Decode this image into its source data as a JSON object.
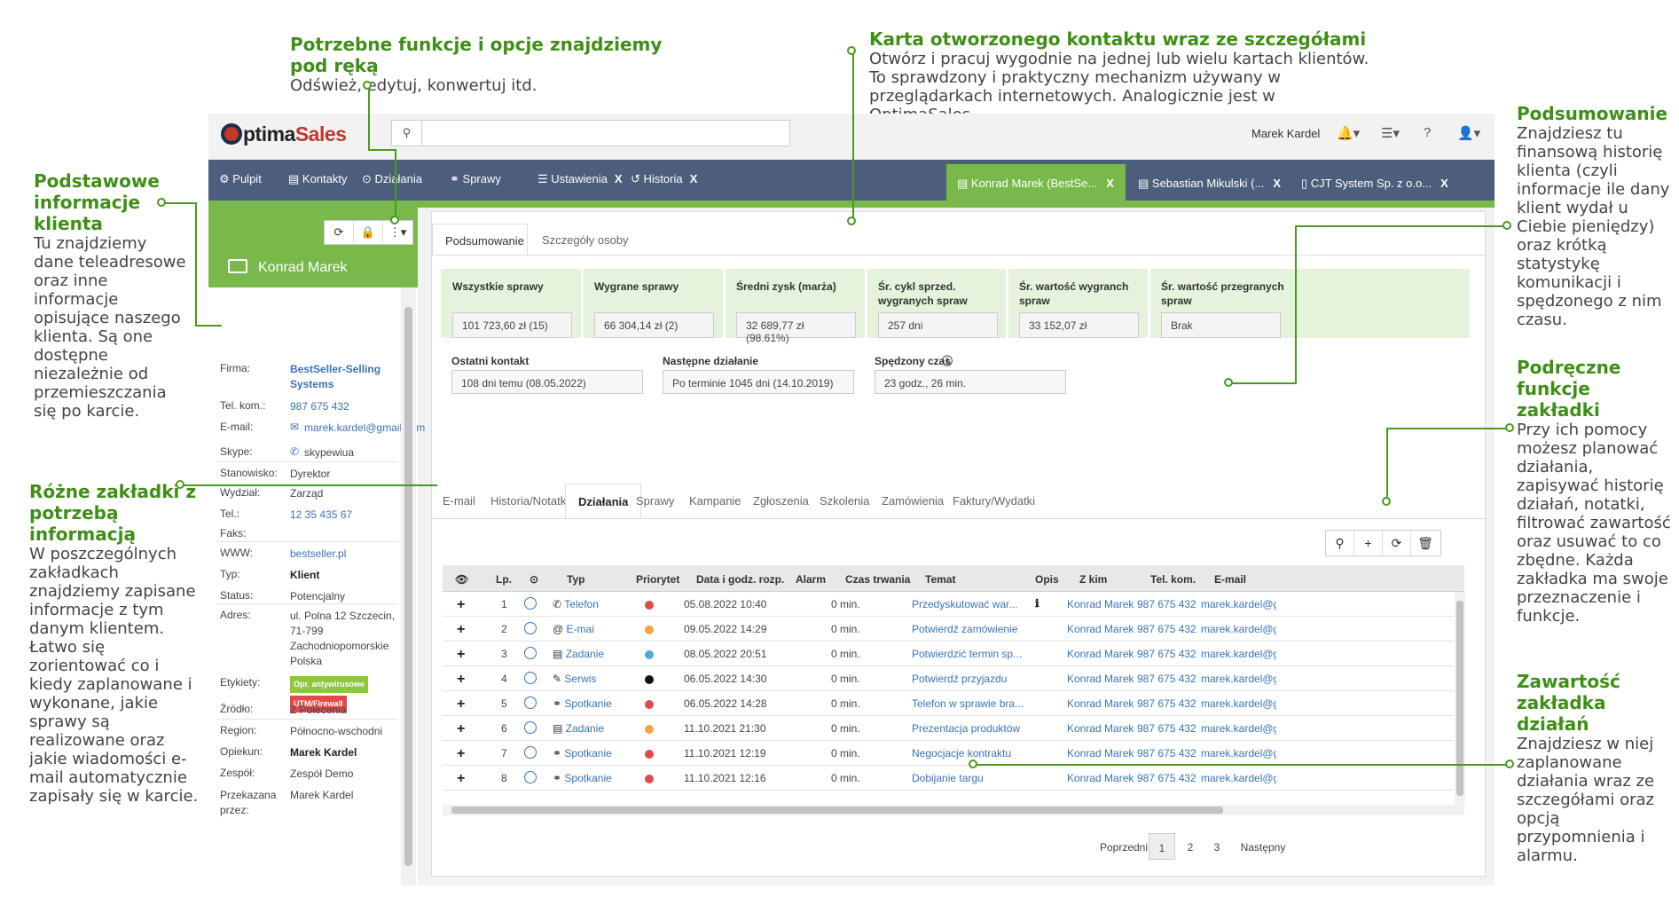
{
  "annotations": [
    {
      "id": "functions",
      "title": "Potrzebne funkcje i opcje znajdziemy pod ręką",
      "desc": "Odśwież, edytuj, konwertuj itd."
    },
    {
      "id": "card",
      "title": "Karta otworzonego kontaktu wraz ze szczegółami",
      "desc": "Otwórz i pracuj wygodnie na jednej lub wielu kartach klientów. To sprawdzony i praktyczny mechanizm używany w przeglądarkach internetowych. Analogicznie jest w OptimaSales."
    },
    {
      "id": "summary",
      "title": "Podsumowanie",
      "desc": "Znajdziesz tu finansową historię klienta (czyli informacje ile dany klient wydał u Ciebie pieniędzy) oraz krótką statystykę komunikacji i spędzonego z nim czasu."
    },
    {
      "id": "basic",
      "title": "Podstawowe informacje klienta",
      "desc": "Tu znajdziemy dane teleadresowe oraz inne informacje opisujące naszego klienta. Są one dostępne niezależnie od przemieszczania się po karcie."
    },
    {
      "id": "tabfunc",
      "title": "Podręczne funkcje zakładki",
      "desc": "Przy ich pomocy możesz planować działania, zapisywać historię działań, notatki, filtrować zawartość oraz usuwać to co zbędne. Każda zakładka ma swoje przeznaczenie i funkcje."
    },
    {
      "id": "tabs",
      "title": "Różne zakładki z potrzebą informacją",
      "desc": "W poszczególnych zakładkach znajdziemy zapisane informacje z tym danym klientem. Łatwo się zorientować co i kiedy zaplanowane i wykonane, jakie sprawy są realizowane oraz jakie wiadomości e-mail automatycznie zapisały się w karcie."
    },
    {
      "id": "content",
      "title": "Zawartość zakładka działań",
      "desc": "Znajdziesz w niej zaplanowane działania wraz ze szczegółami oraz opcją przypomnienia i alarmu."
    }
  ],
  "app": {
    "logo_o": "O",
    "logo_text": "ptima",
    "logo_sales": "Sales",
    "user_name": "Marek Kardel",
    "nav": [
      {
        "label": "Pulpit",
        "icon": "dashboard-icon",
        "glyph": "⚙",
        "closable": false
      },
      {
        "label": "Kontakty",
        "icon": "contacts-icon",
        "glyph": "▤",
        "closable": false
      },
      {
        "label": "Działania",
        "icon": "check-circle-icon",
        "glyph": "⊙",
        "closable": false
      },
      {
        "label": "Sprawy",
        "icon": "handshake-icon",
        "glyph": "⚭",
        "closable": false
      },
      {
        "label": "Ustawienia",
        "icon": "sliders-icon",
        "glyph": "☰",
        "closable": true
      },
      {
        "label": "Historia",
        "icon": "history-icon",
        "glyph": "↺",
        "closable": true
      }
    ],
    "close_glyph": "X",
    "card_tabs": [
      {
        "label": "Konrad Marek (BestSe...",
        "active": true
      },
      {
        "label": "Sebastian Mikulski (...",
        "active": false
      },
      {
        "label": "CJT System Sp. z o.o...",
        "active": false
      }
    ]
  },
  "contact": {
    "name": "Konrad Marek",
    "fields": [
      {
        "key": "Firma:",
        "value": "BestSeller-Selling Systems",
        "style": "link-bold"
      },
      {
        "key": "Tel. kom.:",
        "value": "987 675 432",
        "style": "link"
      },
      {
        "key": "E-mail:",
        "value": "marek.kardel@gmail.com",
        "style": "link"
      },
      {
        "key": "Skype:",
        "value": "skypewiua",
        "style": "plain"
      },
      {
        "key": "Stanowisko:",
        "value": "Dyrektor",
        "style": "plain"
      },
      {
        "key": "Wydział:",
        "value": "Zarząd",
        "style": "plain"
      },
      {
        "key": "Tel.:",
        "value": "12 35 435 67",
        "style": "link"
      },
      {
        "key": "Faks:",
        "value": "",
        "style": "plain"
      },
      {
        "key": "WWW:",
        "value": "bestseller.pl",
        "style": "link"
      },
      {
        "key": "Typ:",
        "value": "Klient",
        "style": "bold"
      },
      {
        "key": "Status:",
        "value": "Potencjalny",
        "style": "plain"
      },
      {
        "key": "Adres:",
        "value": "ul. Polna 12 Szczecin, 71-799 Zachodniopomorskie Polska",
        "style": "plain"
      },
      {
        "key": "Etykiety:",
        "value": "",
        "style": "plain"
      },
      {
        "key": "Źródło:",
        "value": "Z Polecenia",
        "style": "plain"
      },
      {
        "key": "Region:",
        "value": "Północno-wschodni",
        "style": "plain"
      },
      {
        "key": "Opiekun:",
        "value": "Marek Kardel",
        "style": "bold"
      },
      {
        "key": "Zespół:",
        "value": "Zespół Demo",
        "style": "plain"
      },
      {
        "key": "Przekazana przez:",
        "value": "Marek Kardel",
        "style": "plain"
      }
    ],
    "tags": [
      {
        "label": "Opr. antywirusowe",
        "color": "#8dc63f"
      },
      {
        "label": "UTM/Firewall",
        "color": "#e04a4a"
      }
    ]
  },
  "summary_tabs": [
    "Podsumowanie",
    "Szczegóły osoby"
  ],
  "summary": [
    {
      "label": "Wszystkie sprawy",
      "value": "101 723,60 zł (15)"
    },
    {
      "label": "Wygrane sprawy",
      "value": "66 304,14 zł (2)"
    },
    {
      "label": "Średni zysk (marża)",
      "value": "32 689,77 zł (98.61%)"
    },
    {
      "label": "Śr. cykl sprzed. wygranych spraw",
      "value": "257 dni"
    },
    {
      "label": "Śr. wartość wygranch spraw",
      "value": "33 152,07 zł"
    },
    {
      "label": "Śr. wartość przegranych spraw",
      "value": "Brak"
    }
  ],
  "summary2": [
    {
      "label": "Ostatni kontakt",
      "value": "108 dni temu (08.05.2022)"
    },
    {
      "label": "Następne działanie",
      "value": "Po terminie 1045 dni (14.10.2019)"
    },
    {
      "label": "Spędzony czas",
      "value": "23 godz., 26 min."
    }
  ],
  "bottom_tabs": [
    "E-mail",
    "Historia/Notatki",
    "Działania",
    "Sprawy",
    "Kampanie",
    "Zgłoszenia",
    "Szkolenia",
    "Zamówienia",
    "Faktury/Wydatki"
  ],
  "table": {
    "headers": [
      "Lp.",
      "Typ",
      "Priorytet",
      "Data i godz. rozp.",
      "Alarm",
      "Czas trwania",
      "Temat",
      "Opis",
      "Z kim",
      "Tel. kom.",
      "E-mail"
    ],
    "rows": [
      {
        "lp": "1",
        "type": "Telefon",
        "type_glyph": "✆",
        "prio": "#e04a4a",
        "date": "05.08.2022 10:40",
        "dur": "0 min.",
        "topic": "Przedyskutować war...",
        "desc": "ℹ",
        "who": "Konrad Marek",
        "tel": "987 675 432",
        "mail": "marek.kardel@gm"
      },
      {
        "lp": "2",
        "type": "E-mai",
        "type_glyph": "@",
        "prio": "#f5a34a",
        "date": "09.05.2022 14:29",
        "dur": "0 min.",
        "topic": "Potwierdź zamówienie",
        "desc": "",
        "who": "Konrad Marek",
        "tel": "987 675 432",
        "mail": "marek.kardel@gm"
      },
      {
        "lp": "3",
        "type": "Zadanie",
        "type_glyph": "▤",
        "prio": "#4aaee0",
        "date": "08.05.2022 20:51",
        "dur": "0 min.",
        "topic": "Potwierdzić termin sp...",
        "desc": "",
        "who": "Konrad Marek",
        "tel": "987 675 432",
        "mail": "marek.kardel@gm"
      },
      {
        "lp": "4",
        "type": "Serwis",
        "type_glyph": "✎",
        "prio": "#111111",
        "date": "06.05.2022 14:30",
        "dur": "0 min.",
        "topic": "Potwierdź przyjazdu",
        "desc": "",
        "who": "Konrad Marek",
        "tel": "987 675 432",
        "mail": "marek.kardel@gm"
      },
      {
        "lp": "5",
        "type": "Spotkanie",
        "type_glyph": "⚭",
        "prio": "#e04a4a",
        "date": "06.05.2022 14:28",
        "dur": "0 min.",
        "topic": "Telefon w sprawie bra...",
        "desc": "",
        "who": "Konrad Marek",
        "tel": "987 675 432",
        "mail": "marek.kardel@gm"
      },
      {
        "lp": "6",
        "type": "Zadanie",
        "type_glyph": "▤",
        "prio": "#f5a34a",
        "date": "11.10.2021 21:30",
        "dur": "0 min.",
        "topic": "Prezentacja produktów",
        "desc": "",
        "who": "Konrad Marek",
        "tel": "987 675 432",
        "mail": "marek.kardel@gm"
      },
      {
        "lp": "7",
        "type": "Spotkanie",
        "type_glyph": "⚭",
        "prio": "#e04a4a",
        "date": "11.10.2021 12:19",
        "dur": "0 min.",
        "topic": "Negocjacje kontraktu",
        "desc": "",
        "who": "Konrad Marek",
        "tel": "987 675 432",
        "mail": "marek.kardel@gm"
      },
      {
        "lp": "8",
        "type": "Spotkanie",
        "type_glyph": "⚭",
        "prio": "#e04a4a",
        "date": "11.10.2021 12:16",
        "dur": "0 min.",
        "topic": "Dobijanie targu",
        "desc": "",
        "who": "Konrad Marek",
        "tel": "987 675 432",
        "mail": "marek.kardel@gm"
      }
    ]
  },
  "pagination": {
    "prev": "Poprzedni",
    "pages": [
      "1",
      "2",
      "3"
    ],
    "next": "Następny",
    "current": "1"
  }
}
